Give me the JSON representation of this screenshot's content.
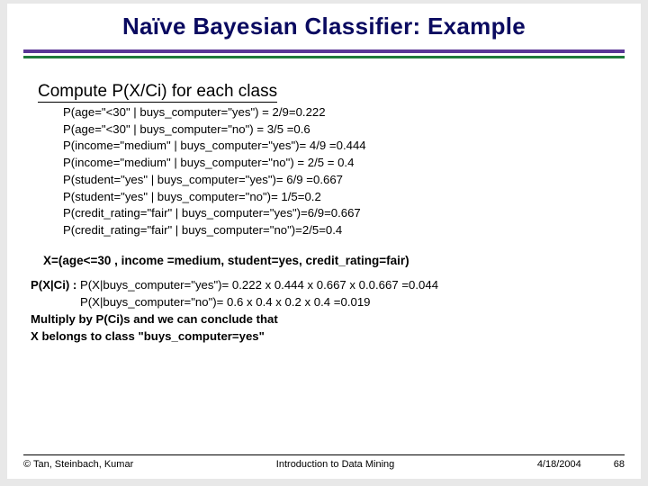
{
  "title": "Naïve Bayesian Classifier:  Example",
  "section_heading": "Compute P(X/Ci) for each class",
  "probs": [
    "P(age=\"<30\" | buys_computer=\"yes\")  = 2/9=0.222",
    "P(age=\"<30\" | buys_computer=\"no\") = 3/5 =0.6",
    "P(income=\"medium\" | buys_computer=\"yes\")= 4/9 =0.444",
    "P(income=\"medium\" | buys_computer=\"no\") = 2/5 = 0.4",
    "P(student=\"yes\" | buys_computer=\"yes\")= 6/9 =0.667",
    "P(student=\"yes\" | buys_computer=\"no\")= 1/5=0.2",
    "P(credit_rating=\"fair\" | buys_computer=\"yes\")=6/9=0.667",
    "P(credit_rating=\"fair\" | buys_computer=\"no\")=2/5=0.4"
  ],
  "x_instance": "X=(age<=30 , income =medium, student=yes, credit_rating=fair)",
  "calc": {
    "label": "P(X|Ci) : ",
    "yes": "P(X|buys_computer=\"yes\")= 0.222 x 0.444 x 0.667 x 0.0.667 =0.044",
    "no_indent": "               ",
    "no": "P(X|buys_computer=\"no\")= 0.6 x 0.4 x 0.2 x 0.4 =0.019",
    "line3": "Multiply by P(Ci)s and we can conclude that",
    "line4": "X belongs to  class \"buys_computer=yes\""
  },
  "footer": {
    "left": "© Tan, Steinbach, Kumar",
    "center": "Introduction to Data Mining",
    "date": "4/18/2004",
    "page": "68"
  }
}
